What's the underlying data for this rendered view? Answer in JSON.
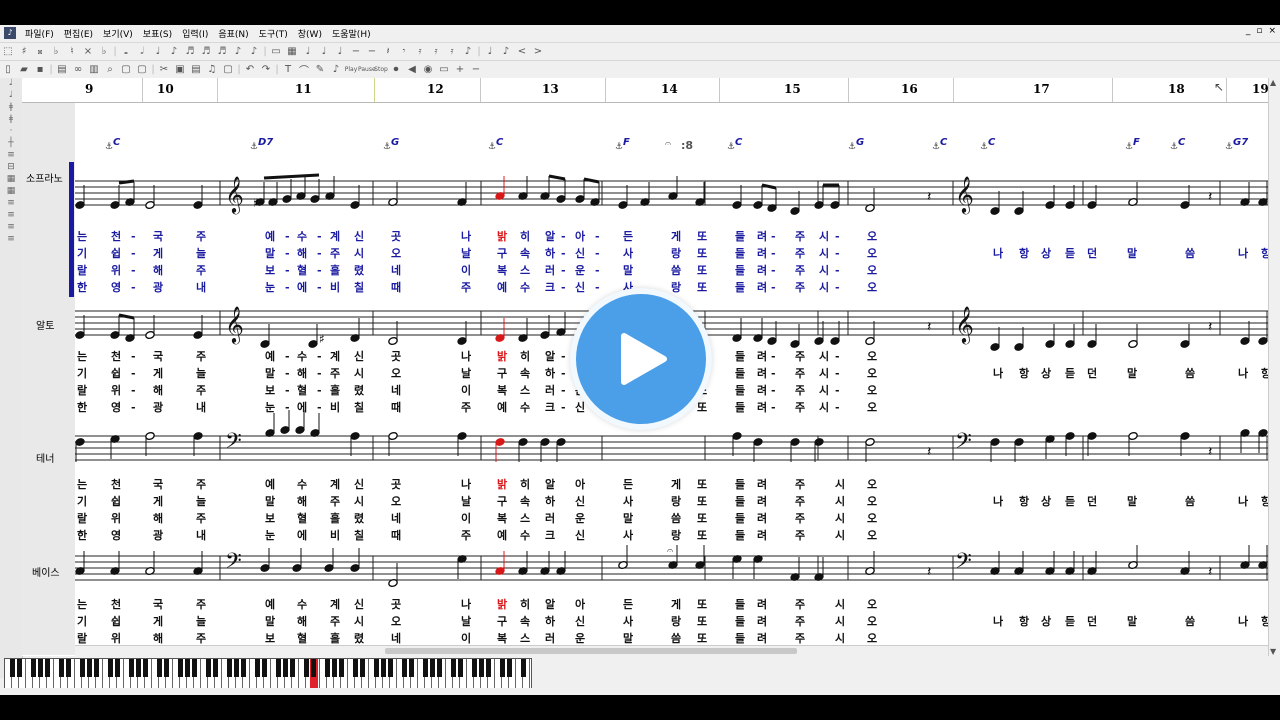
{
  "menu": [
    "파일(F)",
    "편집(E)",
    "보기(V)",
    "보표(S)",
    "입력(I)",
    "음표(N)",
    "도구(T)",
    "창(W)",
    "도움말(H)"
  ],
  "window_controls": [
    "_",
    "▫",
    "×"
  ],
  "toolbar2_labels": {
    "play": "Play",
    "pause": "Pause",
    "stop": "Stop"
  },
  "measures": [
    "9",
    "10",
    "11",
    "12",
    "13",
    "14",
    "15",
    "16",
    "17",
    "18",
    "19"
  ],
  "parts": [
    {
      "name": "소프라노"
    },
    {
      "name": "알토"
    },
    {
      "name": "테너"
    },
    {
      "name": "베이스"
    }
  ],
  "chords": [
    "C",
    "D7",
    "G",
    "C",
    "F",
    "C",
    "G",
    "C",
    "C",
    "F",
    "C",
    "G7"
  ],
  "fermata_mark": "8",
  "lyrics_soprano": [
    [
      "는",
      "천",
      "-",
      "국",
      "주",
      "예",
      "-",
      "수",
      "-",
      "계",
      "신",
      "곳",
      "나",
      "밝",
      "히",
      "알",
      "-",
      "아",
      "-",
      "든",
      "게",
      "또",
      "들",
      "려",
      "-",
      "주",
      "시",
      "-",
      "오"
    ],
    [
      "기",
      "쉽",
      "-",
      "게",
      "늘",
      "말",
      "-",
      "해",
      "-",
      "주",
      "시",
      "오",
      "날",
      "구",
      "속",
      "하",
      "-",
      "신",
      "-",
      "사",
      "랑",
      "또",
      "들",
      "려",
      "-",
      "주",
      "시",
      "-",
      "오"
    ],
    [
      "랄",
      "위",
      "-",
      "해",
      "주",
      "보",
      "-",
      "혈",
      "-",
      "흘",
      "렸",
      "네",
      "이",
      "복",
      "스",
      "러",
      "-",
      "운",
      "-",
      "말",
      "씀",
      "또",
      "들",
      "려",
      "-",
      "주",
      "시",
      "-",
      "오"
    ],
    [
      "한",
      "영",
      "-",
      "광",
      "내",
      "눈",
      "-",
      "에",
      "-",
      "비",
      "칠",
      "때",
      "주",
      "예",
      "수",
      "크",
      "-",
      "신",
      "-",
      "사",
      "랑",
      "또",
      "들",
      "려",
      "-",
      "주",
      "시",
      "-",
      "오"
    ]
  ],
  "lyrics_plain": [
    [
      "는",
      "천",
      "국",
      "주",
      "예",
      "수",
      "계",
      "신",
      "곳",
      "나",
      "밝",
      "히",
      "알",
      "아",
      "든",
      "게",
      "또",
      "들",
      "려",
      "주",
      "시",
      "오"
    ],
    [
      "기",
      "쉽",
      "게",
      "늘",
      "말",
      "해",
      "주",
      "시",
      "오",
      "날",
      "구",
      "속",
      "하",
      "신",
      "사",
      "랑",
      "또",
      "들",
      "려",
      "주",
      "시",
      "오"
    ],
    [
      "랄",
      "위",
      "해",
      "주",
      "보",
      "혈",
      "흘",
      "렸",
      "네",
      "이",
      "복",
      "스",
      "러",
      "운",
      "말",
      "씀",
      "또",
      "들",
      "려",
      "주",
      "시",
      "오"
    ],
    [
      "한",
      "영",
      "광",
      "내",
      "눈",
      "에",
      "비",
      "칠",
      "때",
      "주",
      "예",
      "수",
      "크",
      "신",
      "사",
      "랑",
      "또",
      "들",
      "려",
      "주",
      "시",
      "오"
    ]
  ],
  "lyrics_extra": [
    "나",
    "항",
    "상",
    "듣",
    "던",
    "말",
    "씀",
    "나",
    "항"
  ],
  "colors": {
    "accent": "#1a1aa0",
    "highlight": "#d81818",
    "chord": "#1a1aa0",
    "play_button": "#4a9fe8"
  }
}
